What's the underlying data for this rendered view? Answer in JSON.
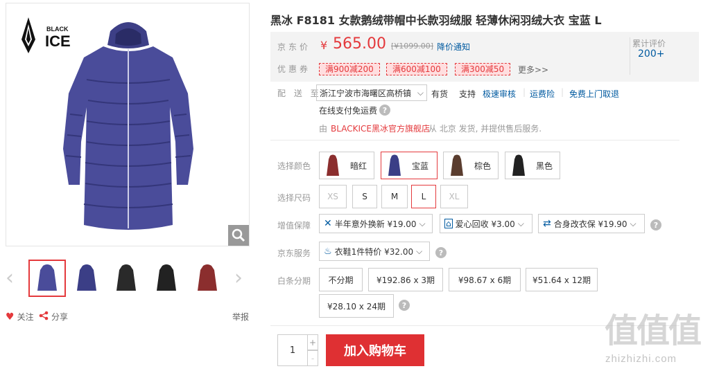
{
  "gallery": {
    "brand_top": "BLACK",
    "brand_bottom": "ICE",
    "follow": "关注",
    "share": "分享",
    "report": "举报"
  },
  "product": {
    "title": "黑冰 F8181 女款鹅绒带帽中长款羽绒服 轻薄休闲羽绒大衣 宝蓝 L"
  },
  "price": {
    "label": "京东价",
    "currency": "¥",
    "value": "565.00",
    "original": "[¥1099.00]",
    "notify": "降价通知",
    "review_label": "累计评价",
    "review_count": "200+"
  },
  "coupons": {
    "label": "优惠券",
    "items": [
      "满900减200",
      "满600减100",
      "满300减50"
    ],
    "more": "更多>>"
  },
  "delivery": {
    "label": "配 送 至",
    "address": "浙江宁波市海曙区高桥镇",
    "stock": "有货",
    "support": "支持",
    "services": [
      "极速审核",
      "运费险",
      "免费上门取退"
    ],
    "payment": "在线支付免运费",
    "seller_prefix": "由",
    "seller": "BLACKICE黑冰官方旗舰店",
    "seller_suffix": "从 北京 发货, 并提供售后服务."
  },
  "colors": {
    "label": "选择颜色",
    "items": [
      "暗红",
      "宝蓝",
      "棕色",
      "黑色"
    ],
    "swatch_colors": [
      "#8b2e2e",
      "#3b3e86",
      "#5a3d2f",
      "#222222"
    ]
  },
  "sizes": {
    "label": "选择尺码",
    "items": [
      "XS",
      "S",
      "M",
      "L",
      "XL"
    ]
  },
  "protection": {
    "label": "增值保障",
    "items": [
      "半年意外换新 ¥19.00",
      "爱心回收 ¥3.00",
      "合身改衣保 ¥19.90"
    ]
  },
  "jd_service": {
    "label": "京东服务",
    "item": "衣鞋1件特价 ¥32.00"
  },
  "installments": {
    "label": "白条分期",
    "items": [
      "不分期",
      "¥192.86 x 3期",
      "¥98.67 x 6期",
      "¥51.64 x 12期",
      "¥28.10 x 24期"
    ]
  },
  "cart": {
    "quantity": "1",
    "plus": "+",
    "minus": "-",
    "add_button": "加入购物车"
  },
  "watermark": {
    "glyphs": "值值值",
    "site": "zhizhizhi.com"
  },
  "theme": {
    "accent": "#e4393c",
    "link": "#005aa0"
  }
}
